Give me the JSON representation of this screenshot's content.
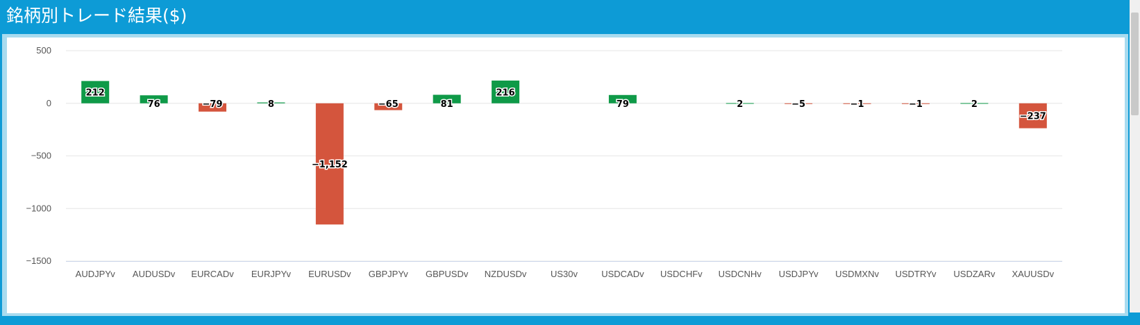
{
  "header": {
    "title": "銘柄別トレード結果($)"
  },
  "colors": {
    "positive": "#0f9a48",
    "negative": "#d4553d",
    "background": "#0d9bd6",
    "grid": "#e6e6e6"
  },
  "chart_data": {
    "type": "bar",
    "title": "",
    "xlabel": "",
    "ylabel": "",
    "ylim": [
      -1500,
      500
    ],
    "yticks": [
      500,
      0,
      -500,
      -1000,
      -1500
    ],
    "ytick_labels": [
      "500",
      "0",
      "−500",
      "−1000",
      "−1500"
    ],
    "grid": true,
    "categories": [
      "AUDJPYv",
      "AUDUSDv",
      "EURCADv",
      "EURJPYv",
      "EURUSDv",
      "GBPJPYv",
      "GBPUSDv",
      "NZDUSDv",
      "US30v",
      "USDCADv",
      "USDCHFv",
      "USDCNHv",
      "USDJPYv",
      "USDMXNv",
      "USDTRYv",
      "USDZARv",
      "XAUUSDv"
    ],
    "values": [
      212,
      76,
      -79,
      8,
      -1152,
      -65,
      81,
      216,
      0,
      79,
      0,
      2,
      -5,
      -1,
      -1,
      2,
      -237
    ],
    "data_labels": [
      "212",
      "76",
      "−79",
      "8",
      "−1,152",
      "−65",
      "81",
      "216",
      "",
      "79",
      "",
      "2",
      "−5",
      "−1",
      "−1",
      "2",
      "−237"
    ]
  }
}
